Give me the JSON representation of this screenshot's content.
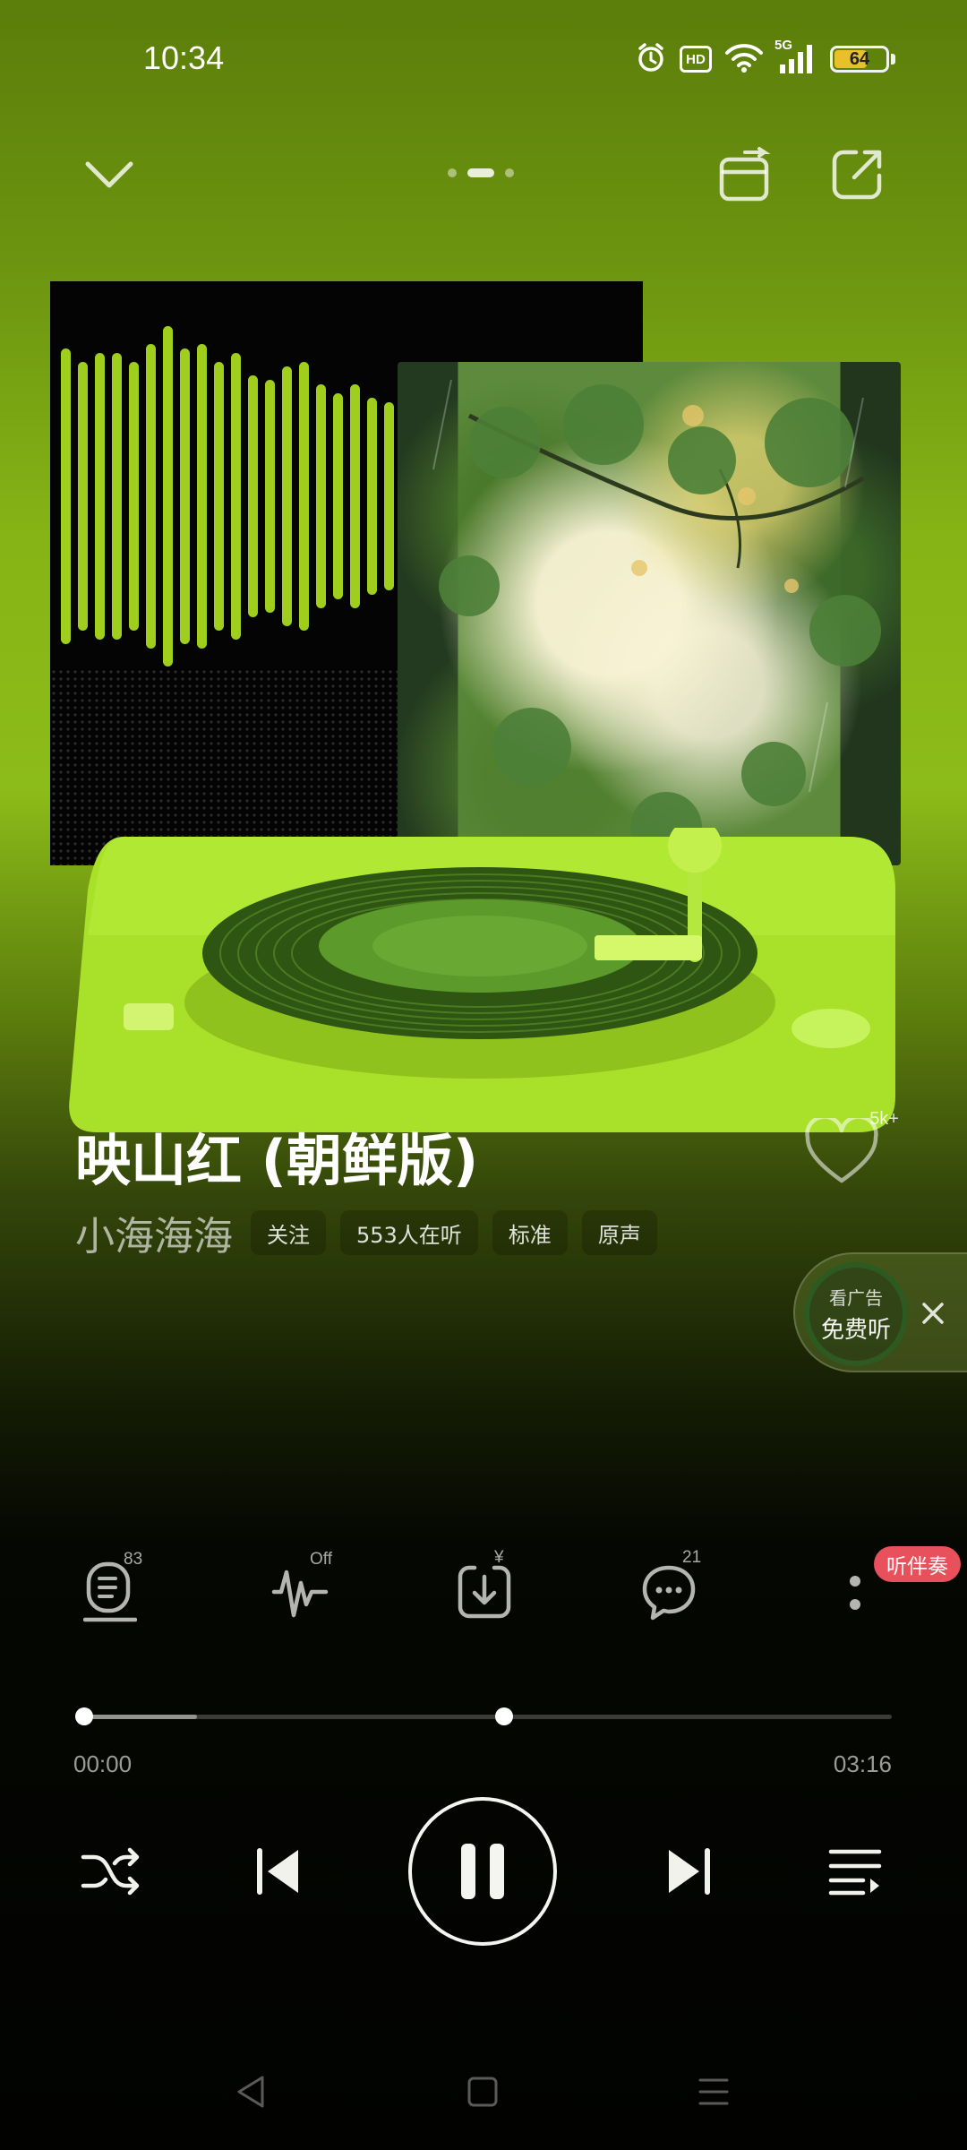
{
  "status_bar": {
    "time": "10:34",
    "hd_label": "HD",
    "network_label": "5G",
    "battery_level": "64",
    "battery_fraction": 0.64,
    "icons": [
      "alarm-icon",
      "hd-icon",
      "wifi-icon",
      "signal-icon",
      "battery-icon"
    ]
  },
  "top_bar": {
    "icons": [
      "chevron-down-icon",
      "device-switch-icon",
      "share-icon"
    ],
    "page_count": 3,
    "active_page": 2
  },
  "song": {
    "title": "映山红 (朝鲜版)",
    "artist": "小海海海",
    "likes": "5k+",
    "tags": [
      "关注",
      "553人在听",
      "标准",
      "原声"
    ]
  },
  "ad": {
    "line1": "看广告",
    "line2": "免费听"
  },
  "actions": {
    "lyrics_count": "83",
    "effect_state": "Off",
    "download_badge": "¥",
    "comments_count": "21",
    "accompaniment_label": "听伴奏"
  },
  "progress": {
    "current": "00:00",
    "total": "03:16",
    "played_fraction": 0.0,
    "buffered_fraction": 0.14,
    "marker_fraction": 0.52
  },
  "controls": {
    "icons": [
      "shuffle-icon",
      "previous-icon",
      "pause-icon",
      "next-icon",
      "playlist-icon"
    ]
  },
  "nav_bar": {
    "icons": [
      "back-icon",
      "home-icon",
      "menu-icon"
    ]
  },
  "colors": {
    "accent_green": "#8cbc19",
    "badge_red": "#e8505c"
  }
}
